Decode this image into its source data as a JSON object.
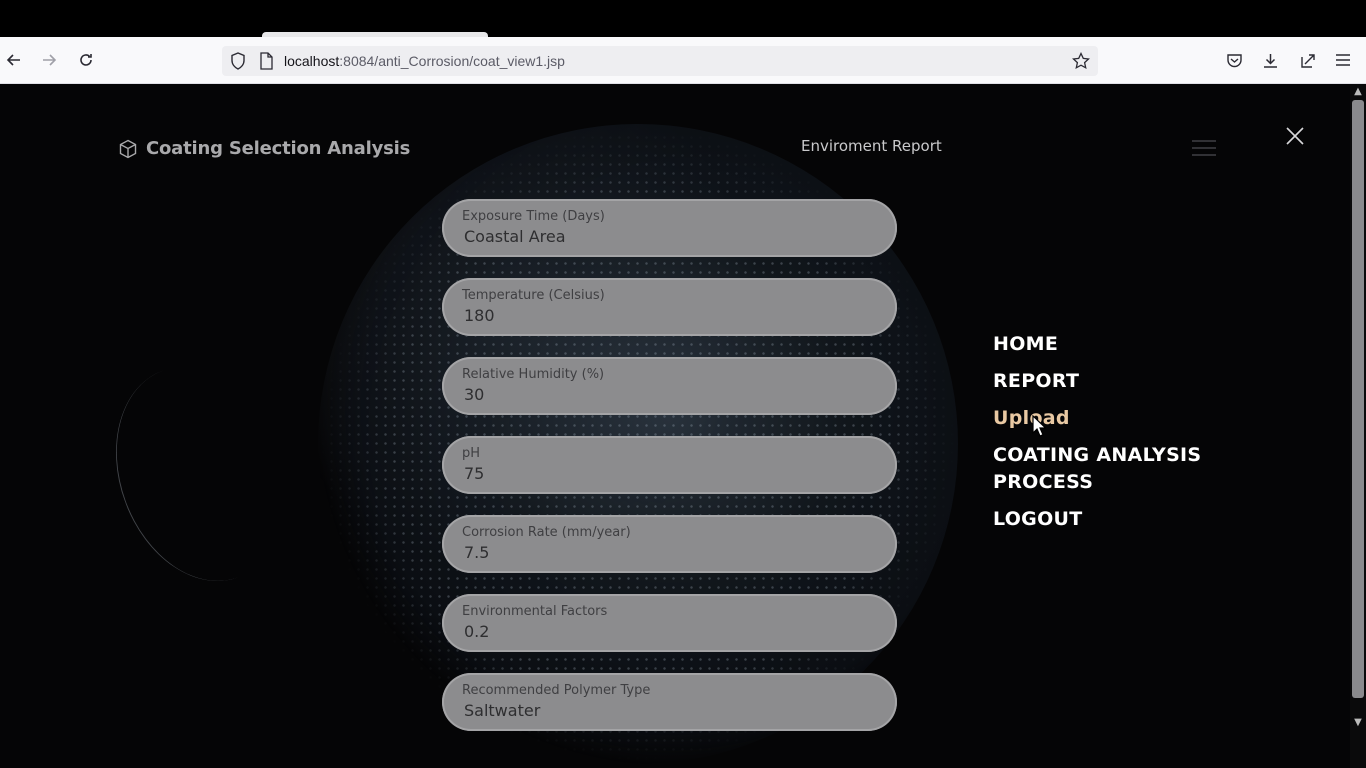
{
  "browser": {
    "url_host": "localhost",
    "url_rest": ":8084/anti_Corrosion/coat_view1.jsp",
    "icons": {
      "back": "arrow-left-icon",
      "forward": "arrow-right-icon",
      "reload": "reload-icon",
      "bookmark": "star-icon",
      "pocket": "pocket-icon",
      "downloads": "download-icon",
      "extensions": "share-icon",
      "menu": "hamburger-icon"
    }
  },
  "header": {
    "brand_title": "Coating Selection Analysis",
    "env_report": "Enviroment Report"
  },
  "form": {
    "fields": [
      {
        "label": "Exposure Time (Days)",
        "value": "Coastal Area"
      },
      {
        "label": "Temperature (Celsius)",
        "value": "180"
      },
      {
        "label": "Relative Humidity (%)",
        "value": "30"
      },
      {
        "label": "pH",
        "value": "75"
      },
      {
        "label": "Corrosion Rate (mm/year)",
        "value": "7.5"
      },
      {
        "label": "Environmental Factors",
        "value": "0.2"
      },
      {
        "label": "Recommended Polymer Type",
        "value": "Saltwater"
      }
    ]
  },
  "menu": {
    "items": [
      {
        "label": "HOME"
      },
      {
        "label": "REPORT"
      },
      {
        "label": "Upload"
      },
      {
        "label": "COATING ANALYSIS PROCESS"
      },
      {
        "label": "LOGOUT"
      }
    ]
  },
  "colors": {
    "menu_active": "#e9c9a3",
    "field_bg": "#8c8c8e",
    "page_bg": "#050506"
  }
}
